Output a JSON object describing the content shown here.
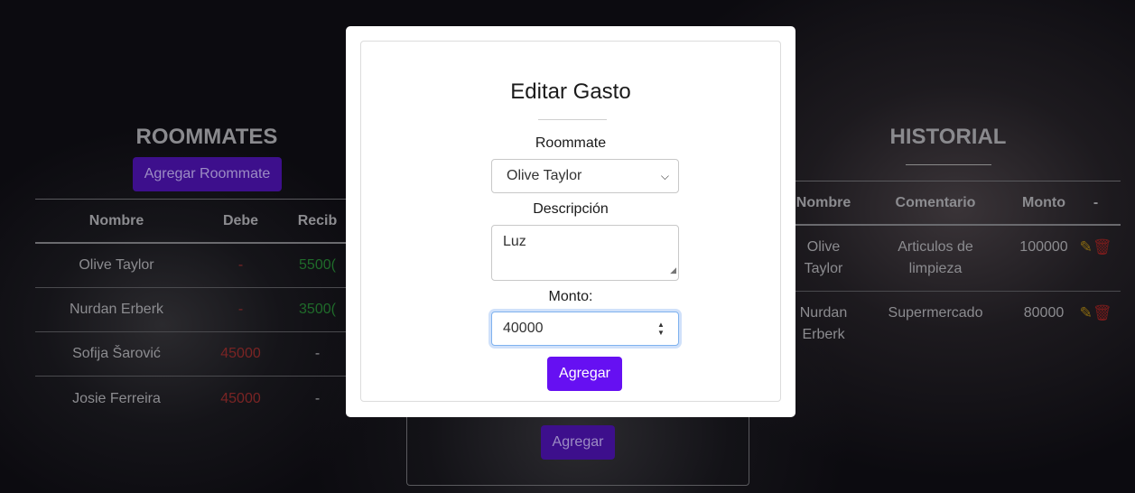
{
  "roommates": {
    "title": "ROOMMATES",
    "add_button": "Agregar Roommate",
    "columns": [
      "Nombre",
      "Debe",
      "Recib"
    ],
    "rows": [
      {
        "nombre": "Olive Taylor",
        "debe": "-",
        "recibe": "5500("
      },
      {
        "nombre": "Nurdan Erberk",
        "debe": "-",
        "recibe": "3500("
      },
      {
        "nombre": "Sofija Šarović",
        "debe": "45000",
        "recibe": "-"
      },
      {
        "nombre": "Josie Ferreira",
        "debe": "45000",
        "recibe": "-"
      }
    ]
  },
  "historial": {
    "title": "HISTORIAL",
    "columns": [
      "Nombre",
      "Comentario",
      "Monto",
      "-"
    ],
    "rows": [
      {
        "nombre_l1": "Olive",
        "nombre_l2": "Taylor",
        "comentario_l1": "Articulos de",
        "comentario_l2": "limpieza",
        "monto": "100000"
      },
      {
        "nombre_l1": "Nurdan",
        "nombre_l2": "Erberk",
        "comentario_l1": "Supermercado",
        "comentario_l2": "",
        "monto": "80000"
      }
    ]
  },
  "background_form": {
    "submit_label": "Agregar"
  },
  "modal": {
    "title": "Editar Gasto",
    "roommate_label": "Roommate",
    "roommate_selected": "Olive Taylor",
    "descripcion_label": "Descripción",
    "descripcion_value": "Luz",
    "monto_label": "Monto:",
    "monto_value": "40000",
    "submit_label": "Agregar"
  },
  "colors": {
    "accent": "#6610f2",
    "debt": "#7a2424",
    "credit": "#1f6b2a"
  }
}
